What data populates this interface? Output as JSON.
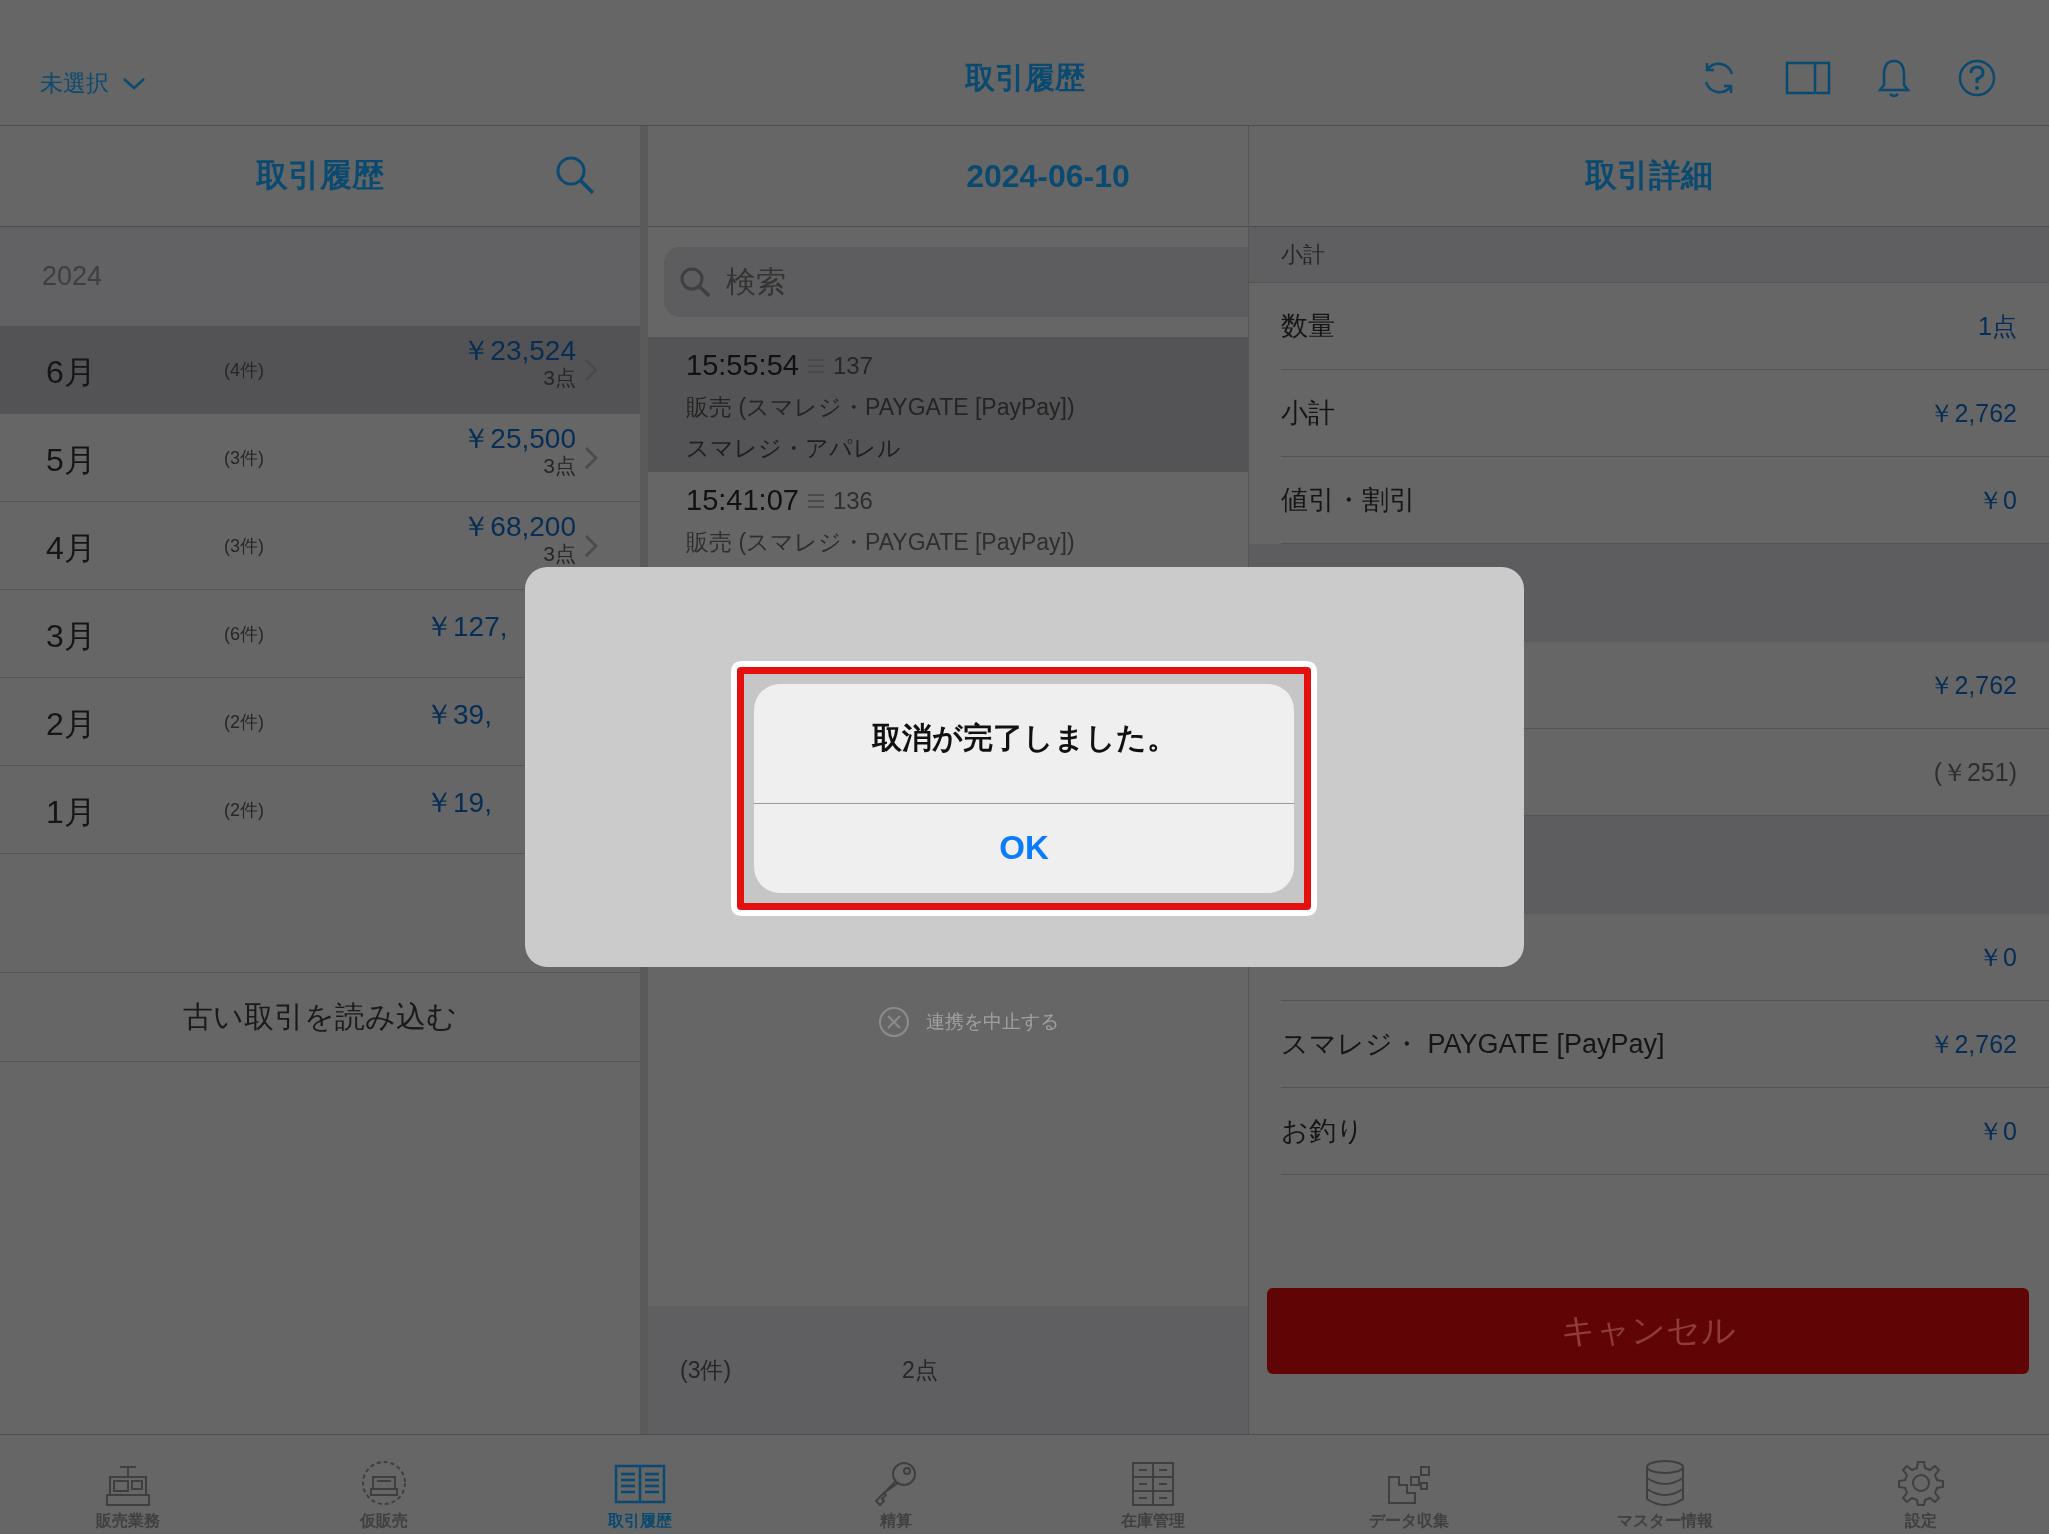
{
  "top_bar": {
    "store_selector": "未選択",
    "title": "取引履歴"
  },
  "history_panel": {
    "title": "取引履歴",
    "year": "2024",
    "months": [
      {
        "month": "6月",
        "count": "(4件)",
        "amount": "￥23,524",
        "items": "3点",
        "selected": true
      },
      {
        "month": "5月",
        "count": "(3件)",
        "amount": "￥25,500",
        "items": "3点",
        "selected": false
      },
      {
        "month": "4月",
        "count": "(3件)",
        "amount": "￥68,200",
        "items": "3点",
        "selected": false
      },
      {
        "month": "3月",
        "count": "(6件)",
        "amount": "￥127,",
        "selected": false
      },
      {
        "month": "2月",
        "count": "(2件)",
        "amount": "￥39,",
        "selected": false
      },
      {
        "month": "1月",
        "count": "(2件)",
        "amount": "￥19,",
        "selected": false
      }
    ],
    "load_older": "古い取引を読み込む"
  },
  "day_panel": {
    "title": "2024-06-10",
    "search": {
      "placeholder": "検索"
    },
    "transactions": [
      {
        "time": "15:55:54",
        "number": "137",
        "type": "販売 (スマレジ・PAYGATE [PayPay])",
        "store": "スマレジ・アパレル",
        "selected": true
      },
      {
        "time": "15:41:07",
        "number": "136",
        "type": "販売 (スマレジ・PAYGATE [PayPay])",
        "selected": false
      }
    ],
    "stop_link": "連携を中止する",
    "footer": {
      "count": "(3件)",
      "items": "2点"
    }
  },
  "detail_panel": {
    "title": "取引詳細",
    "rows": [
      {
        "kind": "header",
        "label": "小計"
      },
      {
        "kind": "amount",
        "label": "数量",
        "value": "1点"
      },
      {
        "kind": "amount",
        "label": "小計",
        "value": "￥2,762"
      },
      {
        "kind": "amount",
        "label": "値引・割引",
        "value": "￥0"
      },
      {
        "kind": "gap"
      },
      {
        "kind": "amount",
        "value": "￥2,762"
      },
      {
        "kind": "note",
        "value": "(￥251)"
      },
      {
        "kind": "gap"
      },
      {
        "kind": "amount",
        "value": "￥0"
      },
      {
        "kind": "amount",
        "label": "スマレジ・ PAYGATE [PayPay]",
        "value": "￥2,762"
      },
      {
        "kind": "amount",
        "label": "お釣り",
        "value": "￥0"
      }
    ],
    "cancel_button": "キャンセル"
  },
  "tab_bar": [
    {
      "kind": "register",
      "label": "販売業務",
      "selected": false
    },
    {
      "kind": "temp",
      "label": "仮販売",
      "selected": false
    },
    {
      "kind": "book",
      "label": "取引履歴",
      "selected": true
    },
    {
      "kind": "key",
      "label": "精算",
      "selected": false
    },
    {
      "kind": "cabinet",
      "label": "在庫管理",
      "selected": false
    },
    {
      "kind": "blocks",
      "label": "データ収集",
      "selected": false
    },
    {
      "kind": "database",
      "label": "マスター情報",
      "selected": false
    },
    {
      "kind": "gear",
      "label": "設定",
      "selected": false
    }
  ],
  "alert": {
    "message": "取消が完了しました。",
    "button": "OK"
  }
}
